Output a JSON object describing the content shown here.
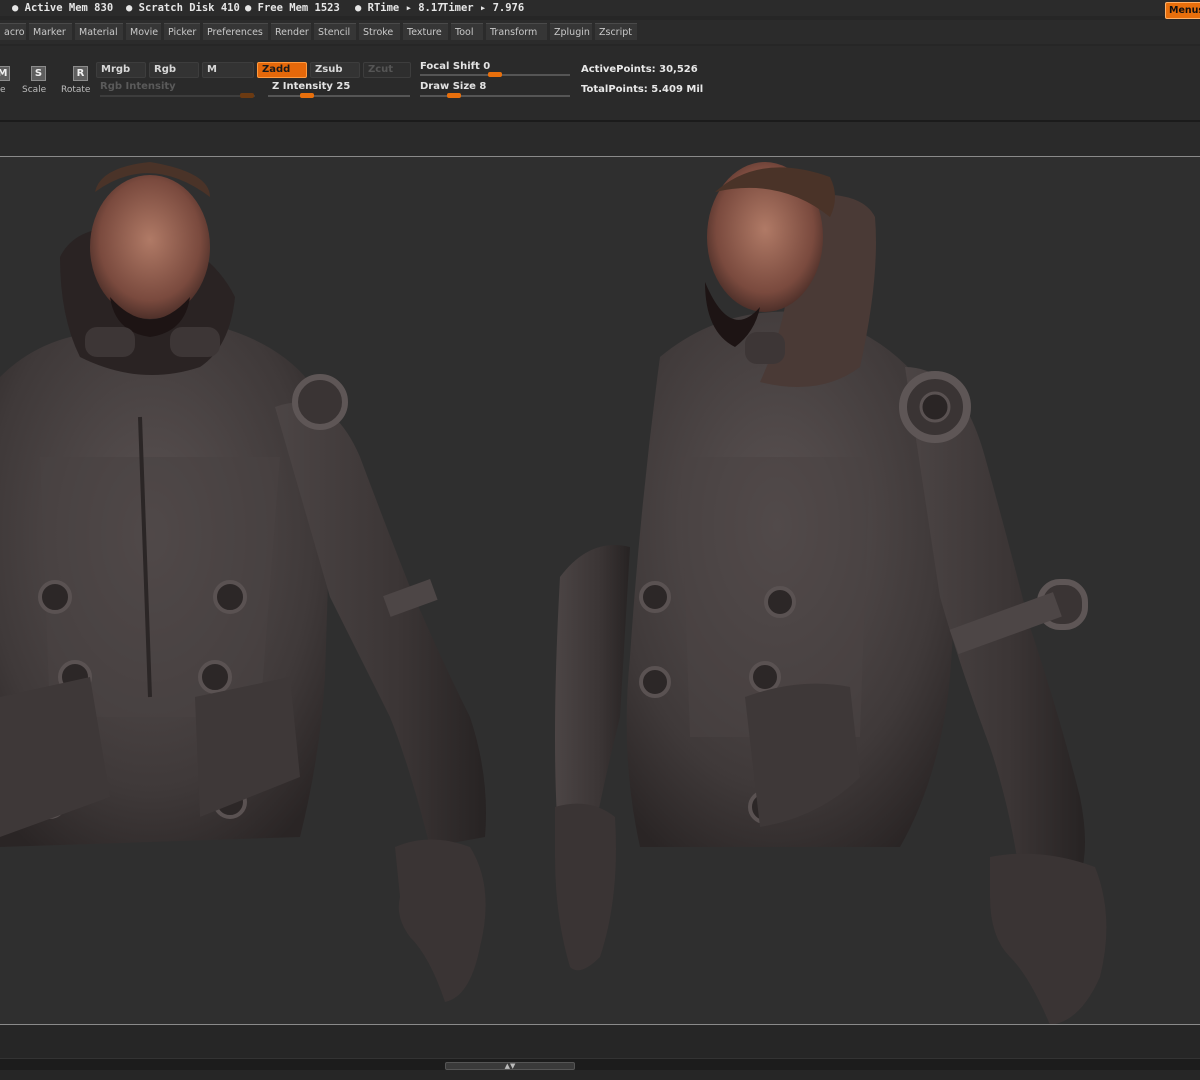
{
  "status_bar": {
    "active_mem": "● Active Mem 830",
    "scratch_disk": "● Scratch Disk 410",
    "free_mem": "● Free Mem 1523",
    "rtime": "● RTime ▸ 8.17",
    "timer": "Timer ▸ 7.976",
    "menus_label": "Menus"
  },
  "menu_bar": {
    "items": [
      "acro",
      "Marker",
      "Material",
      "Movie",
      "Picker",
      "Preferences",
      "Render",
      "Stencil",
      "Stroke",
      "Texture",
      "Tool",
      "Transform",
      "Zplugin",
      "Zscript"
    ]
  },
  "toolbar": {
    "move": {
      "glyph": "M",
      "label": "e"
    },
    "scale": {
      "glyph": "S",
      "label": "Scale"
    },
    "rotate": {
      "glyph": "R",
      "label": "Rotate"
    },
    "mrgb": "Mrgb",
    "rgb": "Rgb",
    "m": "M",
    "zadd": "Zadd",
    "zsub": "Zsub",
    "zcut": "Zcut",
    "rgb_intensity": "Rgb Intensity",
    "z_intensity": {
      "label": "Z Intensity 25",
      "value": 25
    },
    "focal_shift": {
      "label": "Focal Shift 0",
      "value": 0
    },
    "draw_size": {
      "label": "Draw Size 8",
      "value": 8
    },
    "active_points": "ActivePoints: 30,526",
    "total_points": "TotalPoints: 5.409 Mil"
  },
  "colors": {
    "accent": "#e86f0c",
    "ui_bg": "#2a2a2a",
    "canvas_bg": "#2f2f2f",
    "model_base": "#4a4343"
  }
}
